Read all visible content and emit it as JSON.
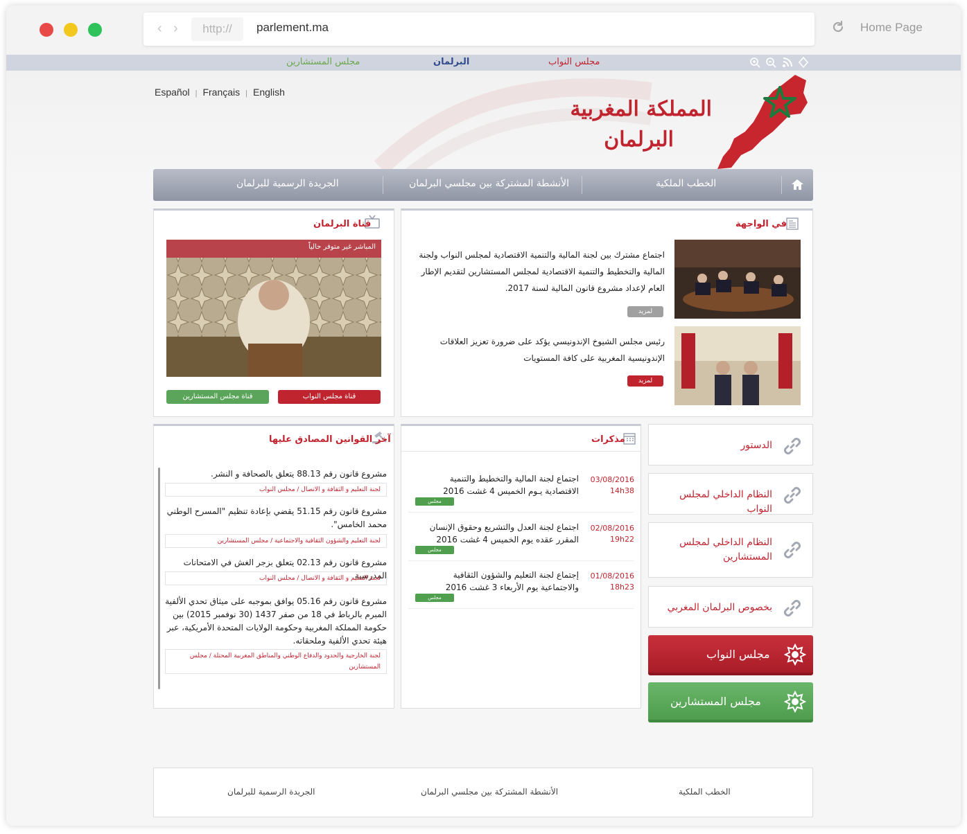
{
  "browser": {
    "protocol": "http://",
    "url": "parlement.ma",
    "home_label": "Home Page",
    "dots": [
      "#e94848",
      "#f3c81e",
      "#2fc25a"
    ]
  },
  "topbar": {
    "left_link": "مجلس المستشارين",
    "center_link": "البرلمان",
    "right_link": "مجلس النواب"
  },
  "languages": [
    "Español",
    "Français",
    "English"
  ],
  "header": {
    "title_line1": "المملكة المغربية",
    "title_line2": "البرلمان"
  },
  "mainnav": {
    "items": [
      "الجريدة الرسمية للبرلمان",
      "الأنشطة المشتركة بين مجلسي البرلمان",
      "الخطب الملكية"
    ]
  },
  "channel": {
    "title": "قناة البرلمان",
    "banner": "المباشر غير متوفر حالياً",
    "btn_counselors": "قناة مجلس المستشارين",
    "btn_representatives": "قناة مجلس النواب"
  },
  "featured": {
    "title": "في الواجهة",
    "items": [
      {
        "text": "اجتماع مشترك بين لجنة المالية والتنمية الاقتصادية لمجلس النواب ولجنة المالية والتخطيط والتنمية الاقتصادية لمجلس المستشارين لتقديم الإطار العام لإعداد مشروع قانون المالية لسنة 2017.",
        "more": "لمزيد"
      },
      {
        "text": "رئيس مجلس الشيوخ الإندونيسي يؤكد على ضرورة تعزيز العلاقات الإندونيسية المغربية على كافة المستويات",
        "more": "لمزيد"
      }
    ]
  },
  "laws": {
    "title": "آخر القوانين المصادق عليها",
    "items": [
      {
        "text": "مشروع قانون رقم 88.13 يتعلق بالصحافة و النشر.",
        "tag": "لجنة التعليم و الثقافة و الاتصال / مجلس النواب"
      },
      {
        "text": "مشروع قانون رقم 51.15 يقضي بإعادة تنظيم \"المسرح الوطني محمد الخامس\".",
        "tag": "لجنة التعليم والشؤون الثقافية والاجتماعية / مجلس المستشارين"
      },
      {
        "text": "مشروع قانون رقم 02.13 يتعلق بزجر الغش في الامتحانات المدرسية",
        "tag": "لجنة التعليم و الثقافة و الاتصال / مجلس النواب"
      },
      {
        "text": "مشروع قانون رقم 05.16 يوافق بموجبه على ميثاق تحدي الألفية المبرم بالرباط في 18 من صفر 1437 (30 نوفمبر 2015) بين حكومة المملكة المغربية وحكومة الولايات المتحدة الأمريكية، عبر هيئة تحدي الألفية وملحقاته.",
        "tag": "لجنة الخارجية والحدود والدفاع الوطني والمناطق المغربية المحتلة / مجلس المستشارين"
      }
    ]
  },
  "memos": {
    "title": "مذكرات",
    "items": [
      {
        "date": "03/08/2016",
        "time": "14h38",
        "text": "اجتماع لجنة المالية والتخطيط والتنمية الاقتصادية يـوم الخميس 4 غشت 2016",
        "badge": "مجلس المستشارين"
      },
      {
        "date": "02/08/2016",
        "time": "19h22",
        "text": "اجتماع لجنة العدل والتشريع وحقوق الإنسان المقرر عقده يوم الخميس 4 غشت 2016",
        "badge": "مجلس المستشارين"
      },
      {
        "date": "01/08/2016",
        "time": "18h23",
        "text": "إجتماع لجنة التعليم والشؤون الثقافية والاجتماعية يوم الأربعاء 3 غشت 2016",
        "badge": "مجلس المستشارين"
      }
    ]
  },
  "quicklinks": [
    "الدستور",
    "النظام الداخلي لمجلس النواب",
    "النظام الداخلي لمجلس المستشارين",
    "بخصوص البرلمان المغربي"
  ],
  "chambers": {
    "representatives": "مجلس النواب",
    "counselors": "مجلس المستشارين"
  },
  "footer": [
    "الجريدة الرسمية للبرلمان",
    "الأنشطة المشتركة بين مجلسي البرلمان",
    "الخطب الملكية"
  ],
  "colors": {
    "accent": "#c0242f",
    "green": "#4f9f4f",
    "nav": "#9aa0ae"
  }
}
